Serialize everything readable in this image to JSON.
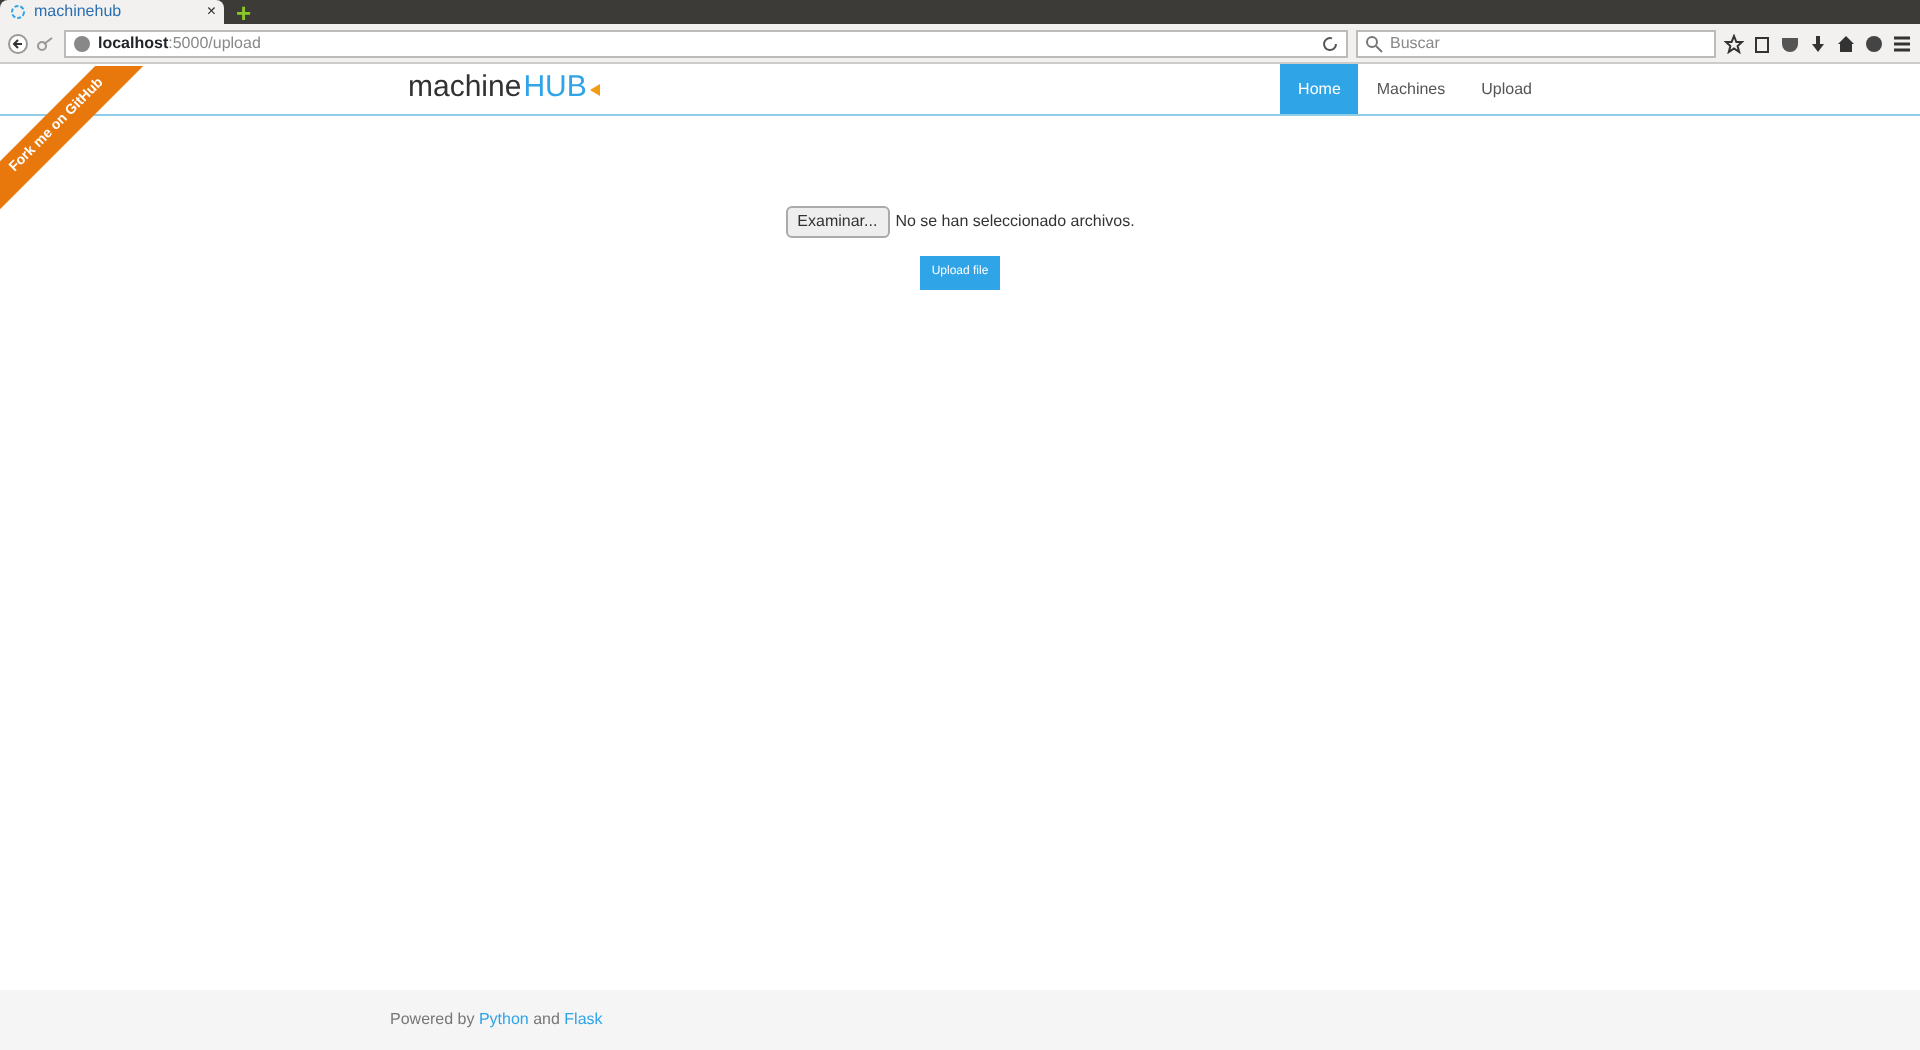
{
  "browser": {
    "tab_title": "machinehub",
    "tab_close": "×",
    "new_tab": "+",
    "url_host": "localhost",
    "url_path": ":5000/upload",
    "search_placeholder": "Buscar"
  },
  "ribbon": {
    "text": "Fork me on GitHub"
  },
  "brand": {
    "plain": "machine",
    "accent": "HUB"
  },
  "nav": [
    {
      "label": "Home",
      "selected": true
    },
    {
      "label": "Machines",
      "selected": false
    },
    {
      "label": "Upload",
      "selected": false
    }
  ],
  "upload": {
    "browse_label": "Examinar...",
    "status": "No se han seleccionado archivos.",
    "submit_label": "Upload file"
  },
  "footer": {
    "parts": [
      {
        "kind": "text",
        "text": "Powered by "
      },
      {
        "kind": "link",
        "text": "Python"
      },
      {
        "kind": "text",
        "text": " and "
      },
      {
        "kind": "link",
        "text": "Flask"
      }
    ]
  }
}
